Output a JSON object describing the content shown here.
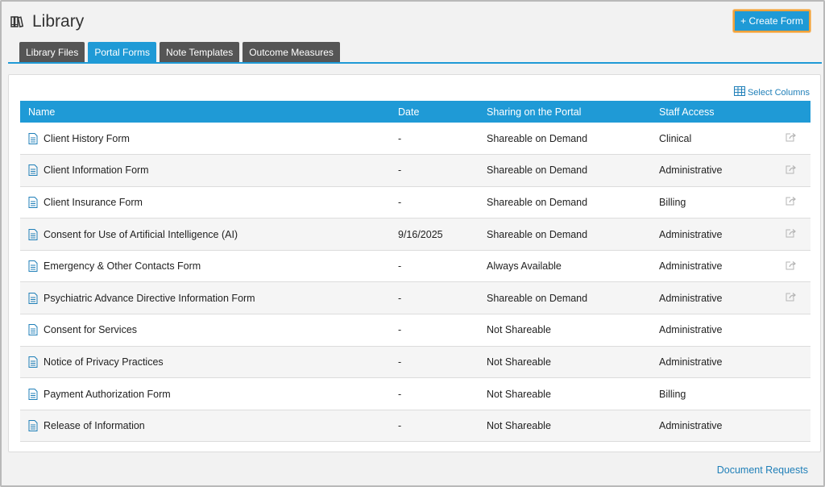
{
  "header": {
    "title": "Library",
    "create_button": "+ Create Form"
  },
  "tabs": [
    {
      "label": "Library Files",
      "active": false
    },
    {
      "label": "Portal Forms",
      "active": true
    },
    {
      "label": "Note Templates",
      "active": false
    },
    {
      "label": "Outcome Measures",
      "active": false
    }
  ],
  "table": {
    "select_columns": "Select Columns",
    "headers": {
      "name": "Name",
      "date": "Date",
      "sharing": "Sharing on the Portal",
      "staff": "Staff Access"
    },
    "rows": [
      {
        "name": "Client History Form",
        "date": "-",
        "sharing": "Shareable on Demand",
        "staff": "Clinical",
        "share_icon": true
      },
      {
        "name": "Client Information Form",
        "date": "-",
        "sharing": "Shareable on Demand",
        "staff": "Administrative",
        "share_icon": true
      },
      {
        "name": "Client Insurance Form",
        "date": "-",
        "sharing": "Shareable on Demand",
        "staff": "Billing",
        "share_icon": true
      },
      {
        "name": "Consent for Use of Artificial Intelligence (AI)",
        "date": "9/16/2025",
        "sharing": "Shareable on Demand",
        "staff": "Administrative",
        "share_icon": true
      },
      {
        "name": "Emergency & Other Contacts Form",
        "date": "-",
        "sharing": "Always Available",
        "staff": "Administrative",
        "share_icon": true
      },
      {
        "name": "Psychiatric Advance Directive Information Form",
        "date": "-",
        "sharing": "Shareable on Demand",
        "staff": "Administrative",
        "share_icon": true
      },
      {
        "name": "Consent for Services",
        "date": "-",
        "sharing": "Not Shareable",
        "staff": "Administrative",
        "share_icon": false
      },
      {
        "name": "Notice of Privacy Practices",
        "date": "-",
        "sharing": "Not Shareable",
        "staff": "Administrative",
        "share_icon": false
      },
      {
        "name": "Payment Authorization Form",
        "date": "-",
        "sharing": "Not Shareable",
        "staff": "Billing",
        "share_icon": false
      },
      {
        "name": "Release of Information",
        "date": "-",
        "sharing": "Not Shareable",
        "staff": "Administrative",
        "share_icon": false
      }
    ]
  },
  "footer": {
    "document_requests": "Document Requests"
  },
  "colors": {
    "accent": "#1f9ad6",
    "link": "#1f7fb8",
    "tab_inactive": "#555555",
    "button_focus": "#f0a13a"
  },
  "icons": {
    "library": "books-icon",
    "select_columns": "table-grid-icon",
    "row_doc": "document-icon",
    "row_share": "share-icon"
  }
}
